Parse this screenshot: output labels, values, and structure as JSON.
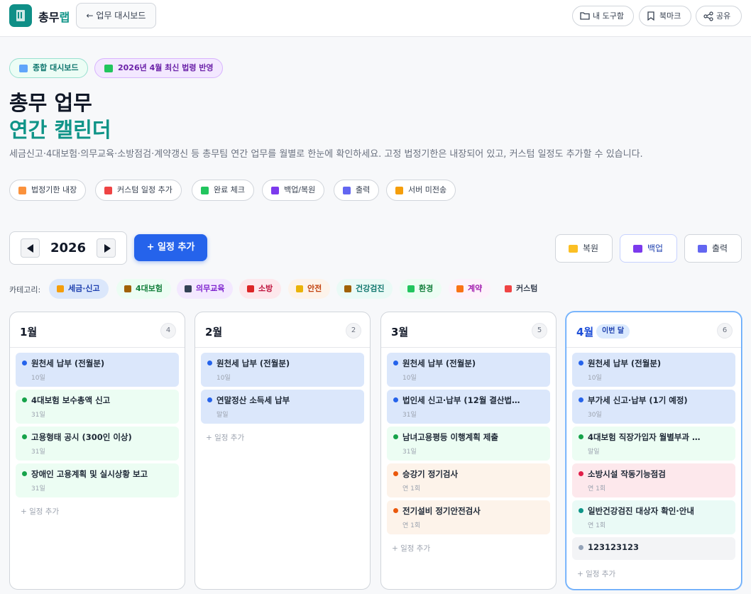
{
  "topbar": {
    "brand_main": "총무",
    "brand_accent": "랩",
    "back_label": "← 업무 대시보드",
    "tools_label": "내 도구함",
    "bookmark_label": "북마크",
    "share_label": "공유"
  },
  "header": {
    "badge_dashboard": "종합 대시보드",
    "badge_law": "2026년 4월 최신 법령 반영",
    "title_line1": "총무 업무",
    "title_line2": "연간 캘린더",
    "lead": "세금신고·4대보험·의무교육·소방점검·계약갱신 등 총무팀 연간 업무를 월별로 한눈에 확인하세요. 고정 법정기한은 내장되어 있고, 커스텀 일정도 추가할 수 있습니다."
  },
  "features": [
    {
      "label": "법정기한 내장",
      "color": "#f97316"
    },
    {
      "label": "커스텀 일정 추가",
      "color": "#ef4444"
    },
    {
      "label": "완료 체크",
      "color": "#22c55e"
    },
    {
      "label": "백업/복원",
      "color": "#7c3aed"
    },
    {
      "label": "출력",
      "color": "#6366f1"
    },
    {
      "label": "서버 미전송",
      "color": "#f59e0b"
    }
  ],
  "controls": {
    "year": "2026",
    "add_label": "+ 일정 추가",
    "restore_label": "복원",
    "backup_label": "백업",
    "print_label": "출력"
  },
  "categories": {
    "label": "카테고리:",
    "items": [
      {
        "label": "세금·신고",
        "bg": "#dbe7fb",
        "fg": "#1e40af",
        "icon": "#f59e0b"
      },
      {
        "label": "4대보험",
        "bg": "#ecfdf3",
        "fg": "#15803d",
        "icon": "#a16207"
      },
      {
        "label": "의무교육",
        "bg": "#f3e8ff",
        "fg": "#7e22ce",
        "icon": "#334155"
      },
      {
        "label": "소방",
        "bg": "#fde8ec",
        "fg": "#be123c",
        "icon": "#dc2626"
      },
      {
        "label": "안전",
        "bg": "#fdf3ea",
        "fg": "#c2410c",
        "icon": "#eab308"
      },
      {
        "label": "건강검진",
        "bg": "#eafaf6",
        "fg": "#0f766e",
        "icon": "#a16207"
      },
      {
        "label": "환경",
        "bg": "#ecfdf3",
        "fg": "#15803d",
        "icon": "#22c55e"
      },
      {
        "label": "계약",
        "bg": "#fdf2fb",
        "fg": "#a21caf",
        "icon": "#f97316"
      },
      {
        "label": "커스텀",
        "bg": "#f7f8fa",
        "fg": "#374151",
        "icon": "#ef4444"
      }
    ]
  },
  "months": [
    {
      "name": "1월",
      "count": "4",
      "now": "",
      "events": [
        {
          "title": "원천세 납부 (전월분)",
          "date": "10일",
          "cat": "tax"
        },
        {
          "title": "4대보험 보수총액 신고",
          "date": "31일",
          "cat": "ins"
        },
        {
          "title": "고용형태 공시 (300인 이상)",
          "date": "31일",
          "cat": "ins"
        },
        {
          "title": "장애인 고용계획 및 실시상황 보고",
          "date": "31일",
          "cat": "ins"
        }
      ]
    },
    {
      "name": "2월",
      "count": "2",
      "now": "",
      "events": [
        {
          "title": "원천세 납부 (전월분)",
          "date": "10일",
          "cat": "tax"
        },
        {
          "title": "연말정산 소득세 납부",
          "date": "말일",
          "cat": "tax"
        }
      ]
    },
    {
      "name": "3월",
      "count": "5",
      "now": "",
      "events": [
        {
          "title": "원천세 납부 (전월분)",
          "date": "10일",
          "cat": "tax"
        },
        {
          "title": "법인세 신고·납부 (12월 결산법…",
          "date": "31일",
          "cat": "tax"
        },
        {
          "title": "남녀고용평등 이행계획 제출",
          "date": "31일",
          "cat": "ins"
        },
        {
          "title": "승강기 정기검사",
          "date": "연 1회",
          "cat": "fac"
        },
        {
          "title": "전기설비 정기안전검사",
          "date": "연 1회",
          "cat": "fac"
        }
      ]
    },
    {
      "name": "4월",
      "count": "6",
      "now": "이번 달",
      "events": [
        {
          "title": "원천세 납부 (전월분)",
          "date": "10일",
          "cat": "tax"
        },
        {
          "title": "부가세 신고·납부 (1기 예정)",
          "date": "30일",
          "cat": "tax"
        },
        {
          "title": "4대보험 직장가입자 월별부과 …",
          "date": "말일",
          "cat": "ins"
        },
        {
          "title": "소방시설 작동기능점검",
          "date": "연 1회",
          "cat": "fire"
        },
        {
          "title": "일반건강검진 대상자 확인·안내",
          "date": "연 1회",
          "cat": "hl"
        },
        {
          "title": "123123123",
          "date": "",
          "cat": "cust"
        }
      ]
    }
  ],
  "add_event_label": "+ 일정 추가"
}
